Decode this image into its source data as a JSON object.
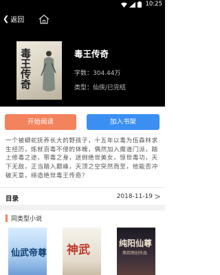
{
  "status_bar": {
    "time": "10:25"
  },
  "nav": {
    "back_label": "返回"
  },
  "book": {
    "title": "毒王传奇",
    "cover_title": "毒王传奇",
    "word_count": "字数：304.44万",
    "category": "类型：仙侠/已完结"
  },
  "actions": {
    "read_label": "开始阅读",
    "shelf_label": "加入书架"
  },
  "description": "一个被蟒蛇抚养长大的野孩子，十五年以毒为伍森林求生经历，炼就百毒不侵的体魄，偶然加入魔道门派，踏上修毒之途，带毒之身，迷倒绝世美女，惊世毒功，天下无敌，正当踏入巅峰，天顶之空突然而至，他能否冲破天意，缔造绝世毒王传奇？",
  "catalog": {
    "label": "目录",
    "date": "2018-11-19",
    "arrow": ">"
  },
  "similar": {
    "heading": "同类型小说",
    "books": [
      {
        "cover_title": "仙武帝尊"
      },
      {
        "cover_title": "神武"
      },
      {
        "cover_title": "纯阳仙尊",
        "cover_subtitle": "燕若雨创作品"
      }
    ]
  },
  "colors": {
    "read_button": "#f3835c",
    "shelf_button": "#3b8ff3",
    "header_bg": "#000000"
  }
}
